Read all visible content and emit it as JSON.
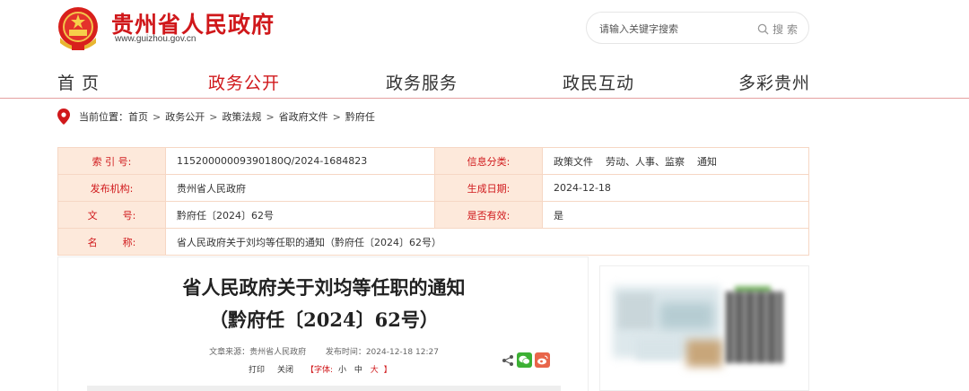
{
  "header": {
    "site_title": "贵州省人民政府",
    "site_url": "www.guizhou.gov.cn",
    "search": {
      "placeholder": "请输入关键字搜索",
      "button_label": "搜 索"
    }
  },
  "nav": {
    "items": [
      {
        "label": "首 页",
        "active": false
      },
      {
        "label": "政务公开",
        "active": true
      },
      {
        "label": "政务服务",
        "active": false
      },
      {
        "label": "政民互动",
        "active": false
      },
      {
        "label": "多彩贵州",
        "active": false
      }
    ]
  },
  "breadcrumb": {
    "prefix": "当前位置：",
    "items": [
      "首页",
      "政务公开",
      "政策法规",
      "省政府文件",
      "黔府任"
    ],
    "separator": ">"
  },
  "meta": {
    "index_label": "索 引 号:",
    "index_value": "11520000009390180Q/2024-1684823",
    "category_label": "信息分类:",
    "category_value": "政策文件    劳动、人事、监察    通知",
    "publisher_label": "发布机构:",
    "publisher_value": "贵州省人民政府",
    "date_label": "生成日期:",
    "date_value": "2024-12-18",
    "docno_label": "文        号:",
    "docno_value": "黔府任〔2024〕62号",
    "valid_label": "是否有效:",
    "valid_value": "是",
    "name_label": "名        称:",
    "name_value": "省人民政府关于刘均等任职的通知（黔府任〔2024〕62号）"
  },
  "article": {
    "title_line1": "省人民政府关于刘均等任职的通知",
    "title_line2": "（黔府任〔2024〕62号）",
    "source": "文章来源：贵州省人民政府",
    "publish_time": "发布时间：2024-12-18 12:27",
    "tools": {
      "print": "打印",
      "close": "关闭",
      "font_prefix": "【字体:",
      "font_small": "小",
      "font_medium": "中",
      "font_large": "大",
      "font_suffix": "】"
    }
  },
  "colors": {
    "brand_red": "#d0181b",
    "meta_key_bg": "#fde9db",
    "meta_border": "#f6d7c4"
  }
}
